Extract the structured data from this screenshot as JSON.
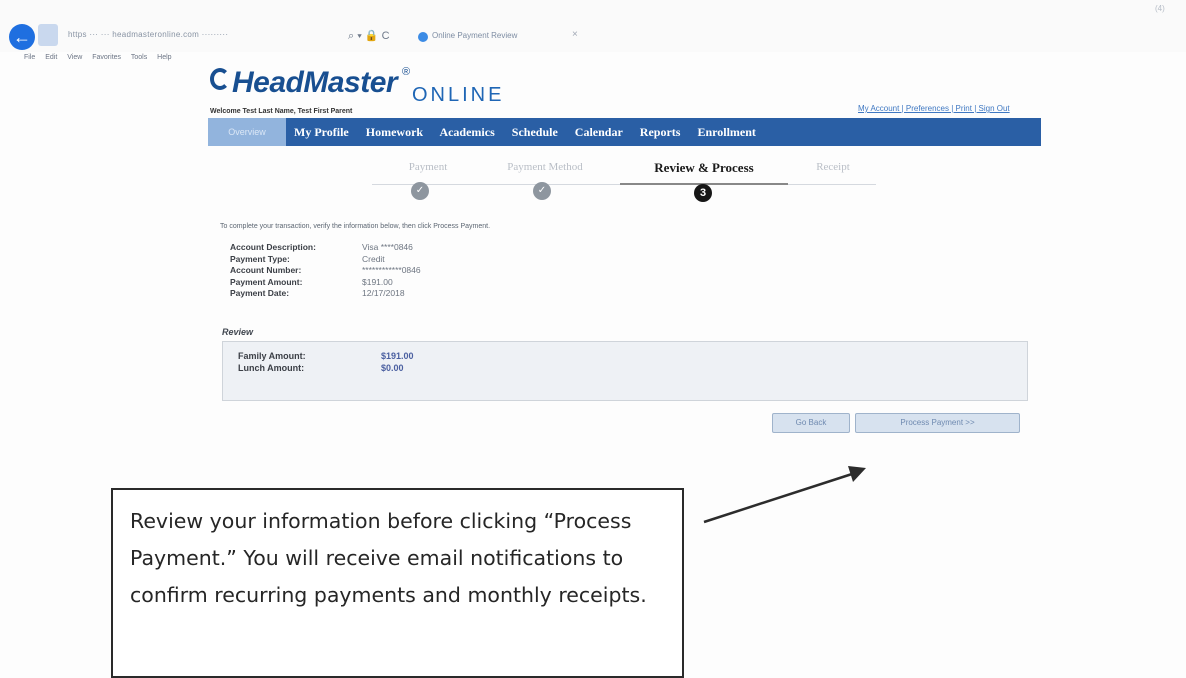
{
  "browser": {
    "back_glyph": "←",
    "address": "https ··· ··· headmasteronline.com   ·········",
    "address_controls": "⌕ ▾ 🔒 C",
    "tab_title": "Online Payment Review",
    "tab_close": "×",
    "corner_text": "(4)",
    "menu": [
      "File",
      "Edit",
      "View",
      "Favorites",
      "Tools",
      "Help"
    ]
  },
  "header": {
    "logo_main": "HeadMaster",
    "logo_reg": "®",
    "logo_online": "ONLINE",
    "welcome": "Welcome Test Last Name, Test First Parent",
    "util_links": "My Account | Preferences | Print | Sign Out"
  },
  "nav": {
    "home": "Overview",
    "items": [
      "My Profile",
      "Homework",
      "Academics",
      "Schedule",
      "Calendar",
      "Reports",
      "Enrollment"
    ]
  },
  "steps": [
    {
      "label": "Payment",
      "state": "done",
      "marker": "✓"
    },
    {
      "label": "Payment Method",
      "state": "done",
      "marker": "✓"
    },
    {
      "label": "Review & Process",
      "state": "active",
      "marker": "3"
    },
    {
      "label": "Receipt",
      "state": "pending",
      "marker": ""
    }
  ],
  "instruction": "To complete your transaction, verify the information below, then click Process Payment.",
  "details": [
    {
      "label": "Account Description:",
      "value": "Visa ****0846"
    },
    {
      "label": "Payment Type:",
      "value": "Credit"
    },
    {
      "label": "Account Number:",
      "value": "************0846"
    },
    {
      "label": "Payment Amount:",
      "value": "$191.00"
    },
    {
      "label": "Payment Date:",
      "value": "12/17/2018"
    }
  ],
  "review": {
    "heading": "Review",
    "rows": [
      {
        "label": "Family Amount:",
        "value": "$191.00"
      },
      {
        "label": "Lunch Amount:",
        "value": "$0.00"
      }
    ]
  },
  "buttons": {
    "back": "Go Back",
    "process": "Process Payment >>"
  },
  "callout": {
    "text": "Review your information before clicking “Process Payment.”  You will receive email notifications to confirm recurring payments and monthly receipts."
  },
  "colors": {
    "nav_bg": "#2a5fa5",
    "logo": "#184f91",
    "back_button": "#1f6fe0"
  }
}
